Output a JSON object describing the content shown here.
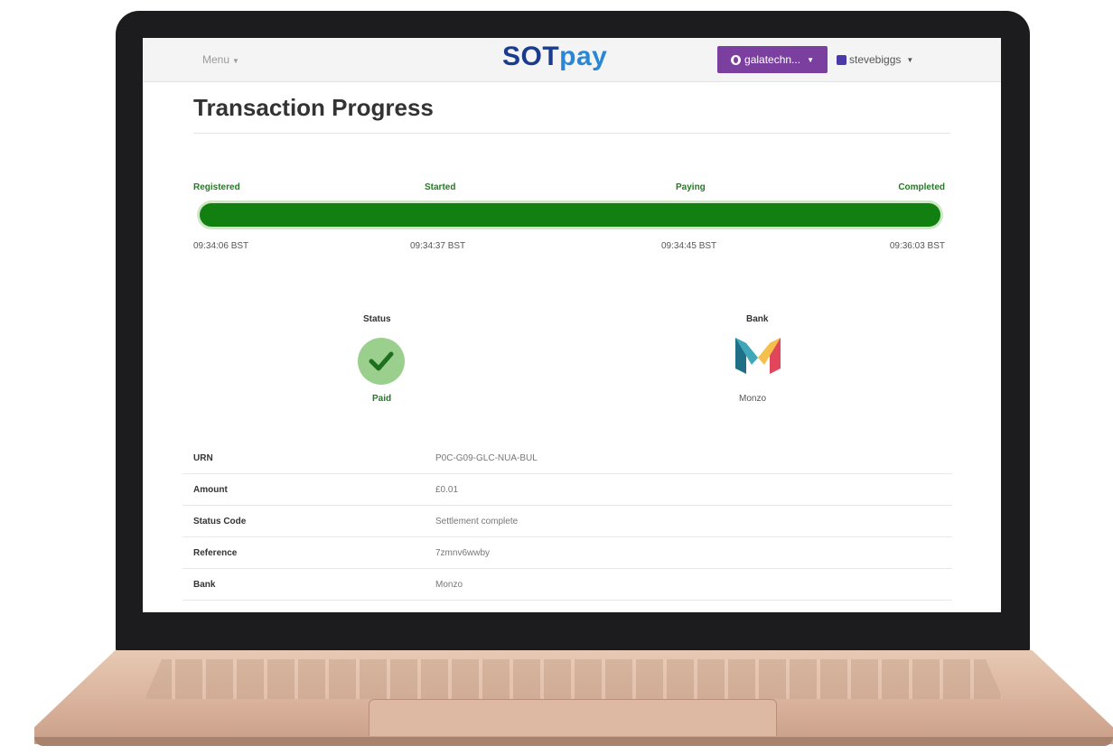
{
  "navbar": {
    "menu_label": "Menu",
    "logo_part1": "SOT",
    "logo_part2": "pay",
    "org_label": "galatechn...",
    "user_label": "stevebiggs",
    "accent": "#7b3fa0"
  },
  "page": {
    "title": "Transaction Progress"
  },
  "progress": {
    "percent": 100,
    "fill_color": "#118011",
    "stages": [
      {
        "label": "Registered",
        "time": "09:34:06 BST"
      },
      {
        "label": "Started",
        "time": "09:34:37 BST"
      },
      {
        "label": "Paying",
        "time": "09:34:45 BST"
      },
      {
        "label": "Completed",
        "time": "09:36:03 BST"
      }
    ]
  },
  "summary": {
    "status_label": "Status",
    "status_value": "Paid",
    "status_icon": "check-circle-icon",
    "bank_label": "Bank",
    "bank_value": "Monzo",
    "bank_icon": "monzo-logo-icon"
  },
  "details": [
    {
      "key": "URN",
      "value": "P0C-G09-GLC-NUA-BUL"
    },
    {
      "key": "Amount",
      "value": "£0.01"
    },
    {
      "key": "Status Code",
      "value": "Settlement complete"
    },
    {
      "key": "Reference",
      "value": "7zmnv6wwby"
    },
    {
      "key": "Bank",
      "value": "Monzo"
    }
  ]
}
